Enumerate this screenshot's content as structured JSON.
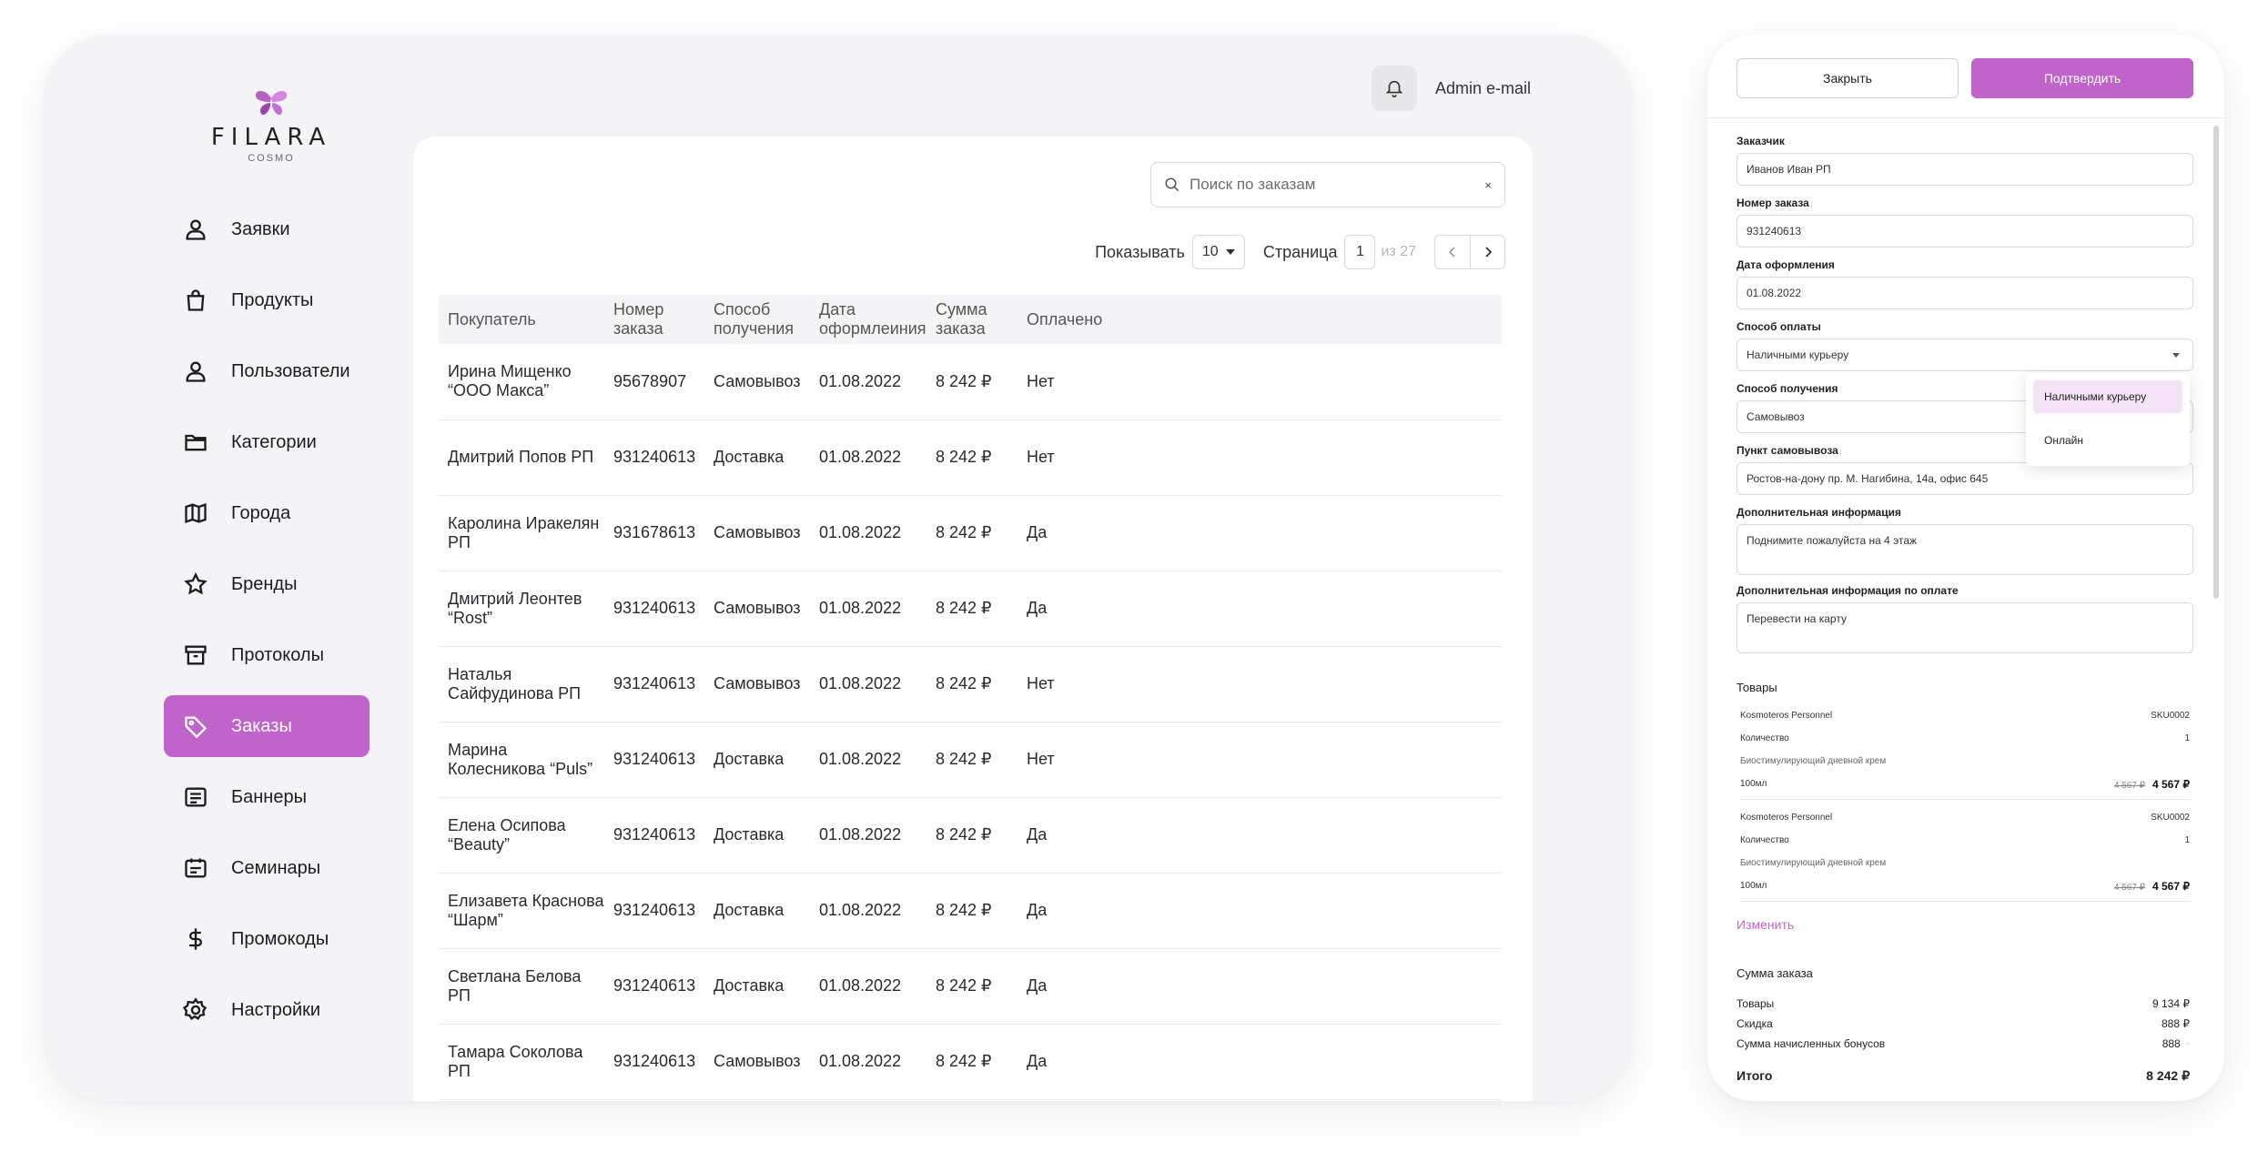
{
  "brand": {
    "name": "FILARA",
    "sub": "COSMO",
    "accent": "#c064cc"
  },
  "header": {
    "user_email": "Admin e-mail"
  },
  "sidebar": {
    "items": [
      {
        "label": "Заявки",
        "icon": "user-icon",
        "active": false
      },
      {
        "label": "Продукты",
        "icon": "bag-icon",
        "active": false
      },
      {
        "label": "Пользователи",
        "icon": "user-icon",
        "active": false
      },
      {
        "label": "Категории",
        "icon": "folder-icon",
        "active": false
      },
      {
        "label": "Города",
        "icon": "map-icon",
        "active": false
      },
      {
        "label": "Бренды",
        "icon": "star-icon",
        "active": false
      },
      {
        "label": "Протоколы",
        "icon": "archive-icon",
        "active": false
      },
      {
        "label": "Заказы",
        "icon": "tag-icon",
        "active": true
      },
      {
        "label": "Баннеры",
        "icon": "banner-icon",
        "active": false
      },
      {
        "label": "Семинары",
        "icon": "calendar-icon",
        "active": false
      },
      {
        "label": "Промокоды",
        "icon": "dollar-icon",
        "active": false
      },
      {
        "label": "Настройки",
        "icon": "gear-icon",
        "active": false
      }
    ]
  },
  "orders": {
    "search_placeholder": "Поиск по заказам",
    "search_clear": "×",
    "show_label": "Показывать",
    "page_size": "10",
    "page_label": "Страница",
    "page_current": "1",
    "page_total": "из 27",
    "columns": [
      "Покупатель",
      "Номер заказа",
      "Способ получения",
      "Дата оформлеиния",
      "Сумма заказа",
      "Оплачено"
    ],
    "rows": [
      [
        "Ирина Мищенко “ООО Макса”",
        "95678907",
        "Самовывоз",
        "01.08.2022",
        "8 242 ₽",
        "Нет"
      ],
      [
        "Дмитрий Попов РП",
        "931240613",
        "Доставка",
        "01.08.2022",
        "8 242 ₽",
        "Нет"
      ],
      [
        "Каролина Иракелян РП",
        "931678613",
        "Самовывоз",
        "01.08.2022",
        "8 242 ₽",
        "Да"
      ],
      [
        "Дмитрий Леонтев “Rost”",
        "931240613",
        "Самовывоз",
        "01.08.2022",
        "8 242 ₽",
        "Да"
      ],
      [
        "Наталья Сайфудинова РП",
        "931240613",
        "Самовывоз",
        "01.08.2022",
        "8 242 ₽",
        "Нет"
      ],
      [
        "Марина Колесникова “Puls”",
        "931240613",
        "Доставка",
        "01.08.2022",
        "8 242 ₽",
        "Нет"
      ],
      [
        "Елена Осипова “Beauty”",
        "931240613",
        "Доставка",
        "01.08.2022",
        "8 242 ₽",
        "Да"
      ],
      [
        "Елизавета Краснова “Шарм”",
        "931240613",
        "Доставка",
        "01.08.2022",
        "8 242 ₽",
        "Да"
      ],
      [
        "Светлана Белова РП",
        "931240613",
        "Доставка",
        "01.08.2022",
        "8 242 ₽",
        "Да"
      ],
      [
        "Тамара Соколова РП",
        "931240613",
        "Самовывоз",
        "01.08.2022",
        "8 242 ₽",
        "Да"
      ]
    ]
  },
  "panel": {
    "close_label": "Закрыть",
    "confirm_label": "Подтвердить",
    "fields": {
      "customer_label": "Заказчик",
      "customer": "Иванов Иван РП",
      "order_no_label": "Номер заказа",
      "order_no": "931240613",
      "date_label": "Дата оформления",
      "date": "01.08.2022",
      "payment_label": "Способ оплаты",
      "payment": "Наличными курьеру",
      "delivery_label": "Способ получения",
      "delivery": "Самовывоз",
      "pickup_label": "Пункт самовывоза",
      "pickup": "Ростов-на-дону пр. М. Нагибина, 14а, офис 645",
      "info_label": "Дополнительная информация",
      "info": "Поднимите пожалуйста на 4 этаж",
      "pay_info_label": "Дополнительная информация по оплате",
      "pay_info": "Перевести на карту"
    },
    "payment_options": [
      "Наличными курьеру",
      "Онлайн"
    ],
    "goods_title": "Товары",
    "products": [
      {
        "name": "Kosmoteros Personnel",
        "sku": "SKU0002",
        "qty_label": "Количество",
        "qty": "1",
        "desc": "Биостимулирующий дневной крем",
        "volume": "100мл",
        "price_old": "4 567 ₽",
        "price": "4 567 ₽"
      },
      {
        "name": "Kosmoteros Personnel",
        "sku": "SKU0002",
        "qty_label": "Количество",
        "qty": "1",
        "desc": "Биостимулирующий дневной крем",
        "volume": "100мл",
        "price_old": "4 567 ₽",
        "price": "4 567 ₽"
      }
    ],
    "edit_label": "Изменить",
    "summary": {
      "title": "Сумма заказа",
      "goods_label": "Товары",
      "goods": "9 134 ₽",
      "discount_label": "Скидка",
      "discount": "888 ₽",
      "bonus_label": "Сумма начисленных бонусов",
      "bonus": "888",
      "total_label": "Итого",
      "total": "8 242 ₽"
    }
  }
}
